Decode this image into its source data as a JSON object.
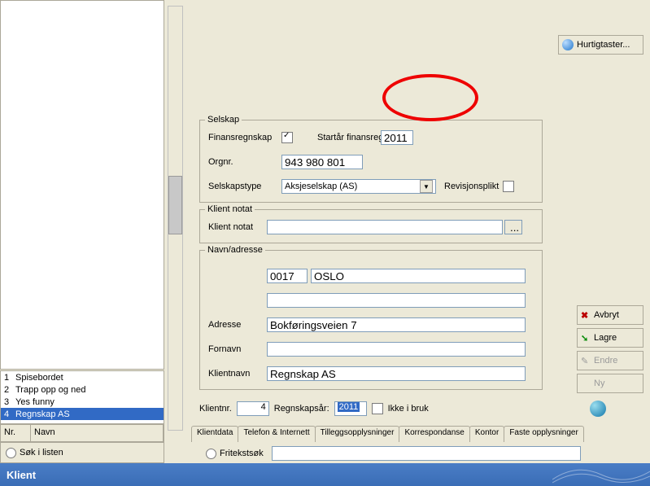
{
  "title": "Klient",
  "hurtig": "Hurtigtaster...",
  "left": {
    "search": "Søk i listen",
    "hdr_nr": "Nr.",
    "hdr_navn": "Navn",
    "items": [
      {
        "nr": "1",
        "navn": "Spisebordet"
      },
      {
        "nr": "2",
        "navn": "Trapp opp og ned"
      },
      {
        "nr": "3",
        "navn": "Yes funny"
      },
      {
        "nr": "4",
        "navn": "Regnskap AS"
      }
    ]
  },
  "search2": "Fritekstsøk",
  "tabs": [
    "Klientdata",
    "Telefon & Internett",
    "Tilleggsopplysninger",
    "Korrespondanse",
    "Kontor",
    "Faste opplysninger"
  ],
  "top": {
    "klientnr_lbl": "Klientnr.",
    "klientnr": "4",
    "year_lbl": "Regnskapsår:",
    "year": "2011",
    "ikke": "Ikke i bruk"
  },
  "nav": {
    "title": "Navn/adresse",
    "klientnavn_lbl": "Klientnavn",
    "klientnavn": "Regnskap AS",
    "fornavn_lbl": "Fornavn",
    "fornavn": "",
    "adresse_lbl": "Adresse",
    "adresse": "Bokføringsveien 7",
    "adresse2": "",
    "postnr": "0017",
    "poststed": "OSLO"
  },
  "note": {
    "title": "Klient notat",
    "lbl": "Klient notat",
    "val": ""
  },
  "sel": {
    "title": "Selskap",
    "type_lbl": "Selskapstype",
    "type": "Aksjeselskap (AS)",
    "rev": "Revisjonsplikt",
    "org_lbl": "Orgnr.",
    "org": "943 980 801",
    "fin": "Finansregnskap",
    "start_lbl": "Startår finansregnskap:",
    "start": "2011"
  },
  "btns": {
    "avbryt": "Avbryt",
    "lagre": "Lagre",
    "endre": "Endre",
    "ny": "Ny"
  }
}
